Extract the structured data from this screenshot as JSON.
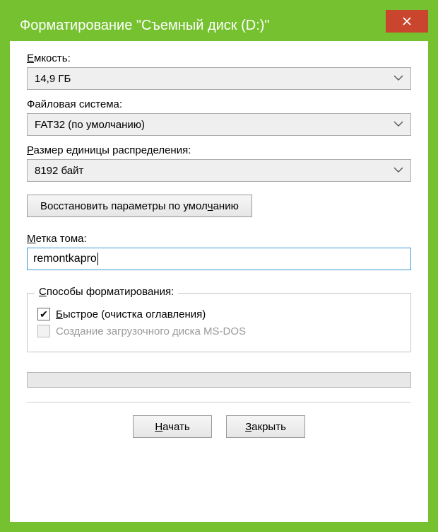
{
  "window": {
    "title": "Форматирование \"Съемный диск (D:)\""
  },
  "capacity": {
    "label_pre": "Е",
    "label_mid": "мкость:",
    "value": "14,9 ГБ"
  },
  "filesystem": {
    "label": "Файловая система:",
    "value": "FAT32 (по умолчанию)"
  },
  "allocunit": {
    "label_pre": "Р",
    "label_mid": "азмер единицы распределения:",
    "value": "8192 байт"
  },
  "restore": {
    "pre": "Восстановить параметры по умол",
    "u": "ч",
    "post": "анию"
  },
  "volumelabel": {
    "label_pre": "М",
    "label_mid": "етка тома:",
    "value": "remontkapro"
  },
  "group": {
    "title_pre": "С",
    "title_mid": "пособы форматирования:",
    "quick_u": "Б",
    "quick_post": "ыстрое (очистка оглавления)",
    "msdos": "Создание загрузочного диска MS-DOS"
  },
  "buttons": {
    "start_u": "Н",
    "start_post": "ачать",
    "close_u": "З",
    "close_post": "акрыть"
  }
}
